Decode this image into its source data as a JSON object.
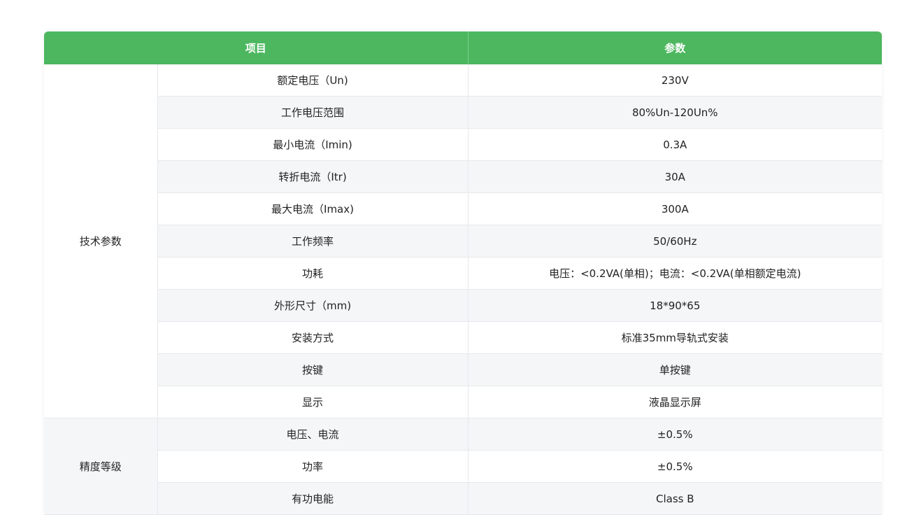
{
  "header": {
    "item_label": "项目",
    "param_label": "参数"
  },
  "groups": [
    {
      "name": "技术参数",
      "rows": [
        {
          "param": "额定电压（Un)",
          "value": "230V"
        },
        {
          "param": "工作电压范围",
          "value": "80%Un-120Un%"
        },
        {
          "param": "最小电流（Imin)",
          "value": "0.3A"
        },
        {
          "param": "转折电流（Itr)",
          "value": "30A"
        },
        {
          "param": "最大电流（Imax)",
          "value": "300A"
        },
        {
          "param": "工作频率",
          "value": "50/60Hz"
        },
        {
          "param": "功耗",
          "value": "电压：<0.2VA(单相)；电流：<0.2VA(单相额定电流)"
        },
        {
          "param": "外形尺寸（mm)",
          "value": "18*90*65"
        },
        {
          "param": "安装方式",
          "value": "标准35mm导轨式安装"
        },
        {
          "param": "按键",
          "value": "单按键"
        },
        {
          "param": "显示",
          "value": "液晶显示屏"
        }
      ]
    },
    {
      "name": "精度等级",
      "rows": [
        {
          "param": "电压、电流",
          "value": "±0.5%"
        },
        {
          "param": "功率",
          "value": "±0.5%"
        },
        {
          "param": "有功电能",
          "value": "Class B"
        }
      ]
    }
  ]
}
